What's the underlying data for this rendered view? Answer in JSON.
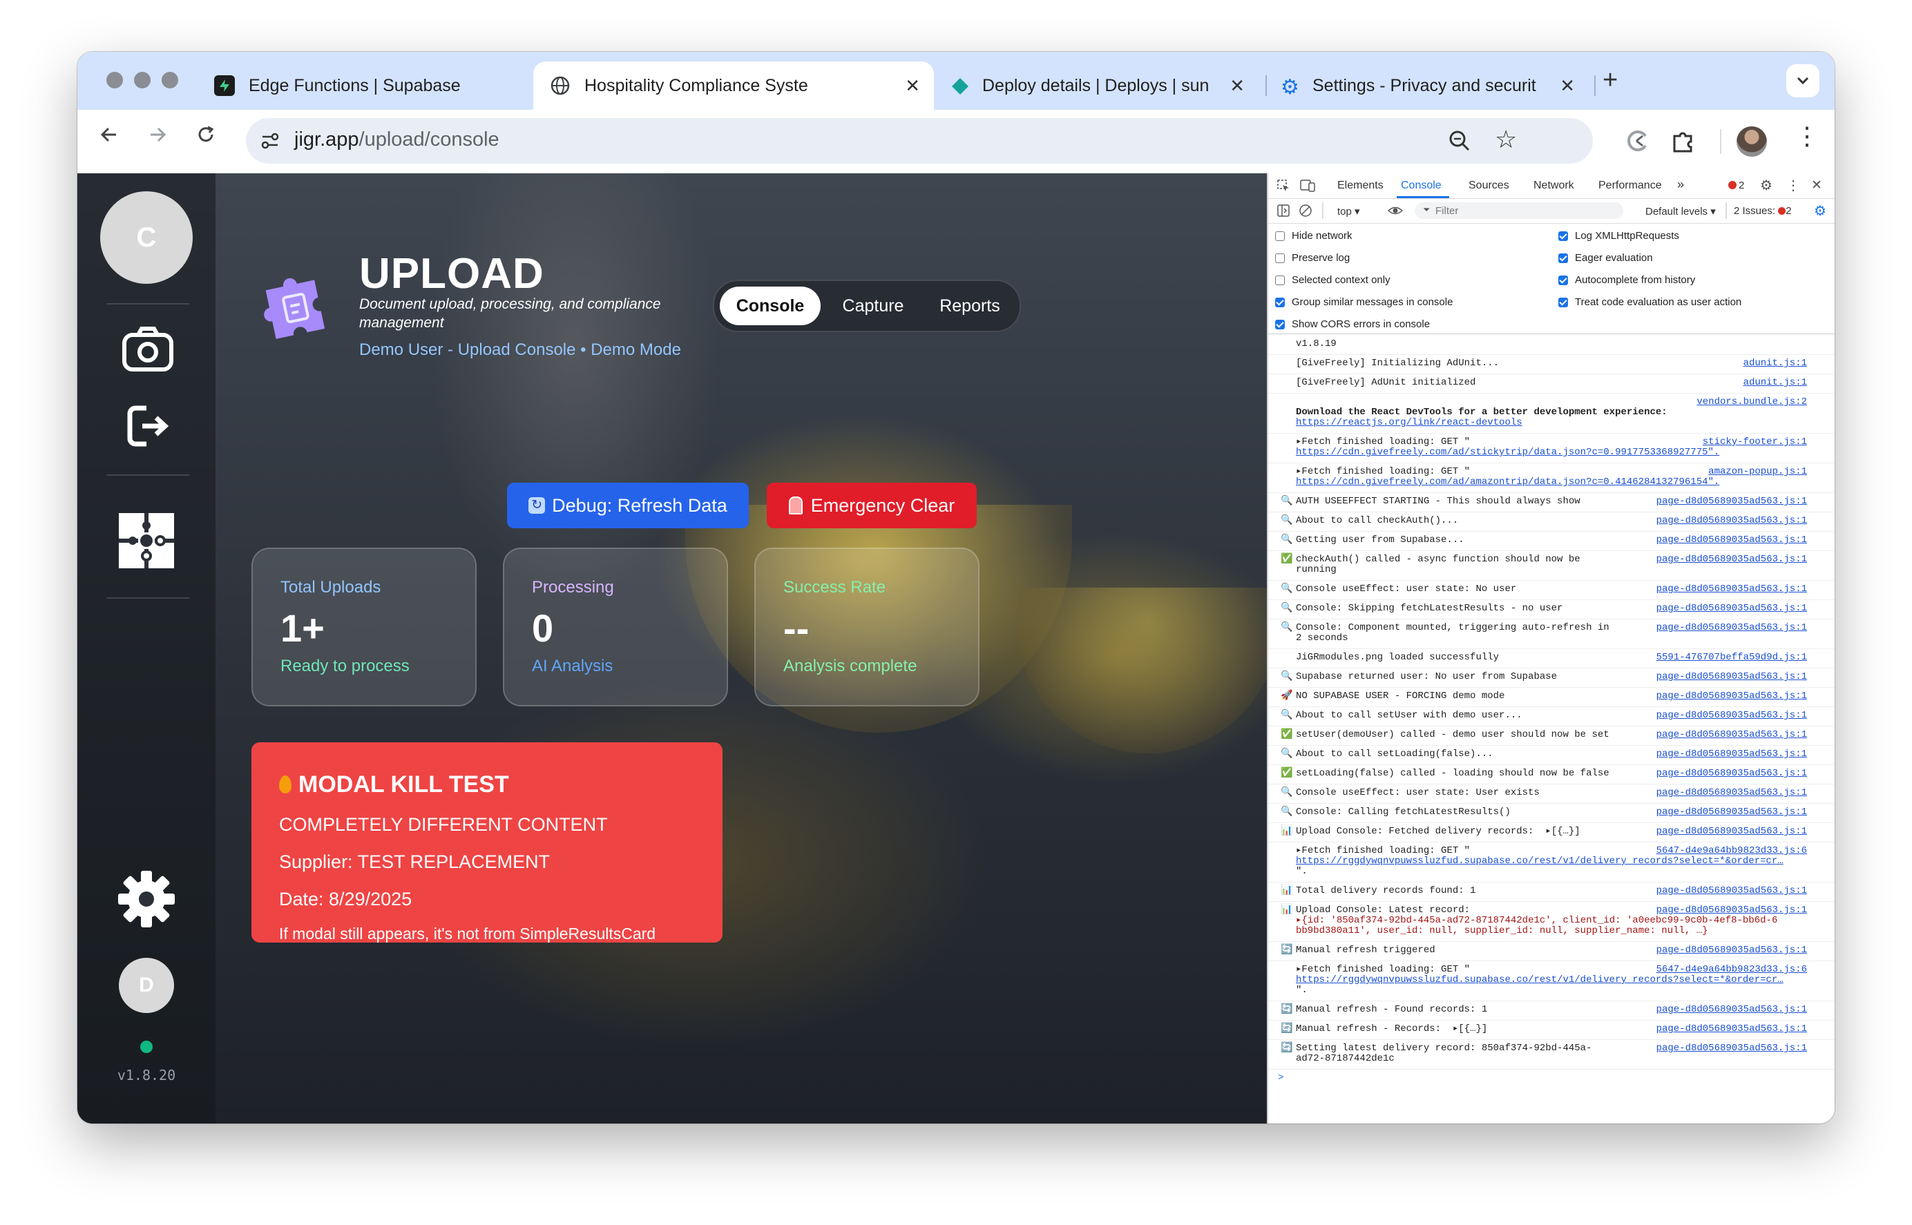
{
  "browser": {
    "tabs": [
      {
        "title": "Edge Functions | Supabase"
      },
      {
        "title": "Hospitality Compliance Syste"
      },
      {
        "title": "Deploy details | Deploys | sun"
      },
      {
        "title": "Settings - Privacy and securit"
      }
    ],
    "url_host": "jigr.app",
    "url_path": "/upload/console"
  },
  "app": {
    "avatar_initial": "C",
    "user_initial": "D",
    "version": "v1.8.20",
    "header": {
      "title": "UPLOAD",
      "subtitle_line1": "Document upload, processing, and compliance",
      "subtitle_line2": "management",
      "context": "Demo User - Upload Console • Demo Mode"
    },
    "nav": [
      "Console",
      "Capture",
      "Reports"
    ],
    "buttons": {
      "debug": "Debug: Refresh Data",
      "emergency": "Emergency Clear"
    },
    "stats": [
      {
        "label": "Total Uploads",
        "value": "1+",
        "sub": "Ready to process"
      },
      {
        "label": "Processing",
        "value": "0",
        "sub": "AI Analysis"
      },
      {
        "label": "Success Rate",
        "value": "--",
        "sub": "Analysis complete"
      }
    ],
    "test_card": {
      "title": "MODAL KILL TEST",
      "line1": "COMPLETELY DIFFERENT CONTENT",
      "line2": "Supplier: TEST REPLACEMENT",
      "line3": "Date: 8/29/2025",
      "line4": "If modal still appears, it's not from SimpleResultsCard"
    },
    "colors": {
      "accent_blue": "#2563eb",
      "danger": "#ef4444",
      "online": "#10b981"
    }
  },
  "devtools": {
    "tabs": [
      "Elements",
      "Console",
      "Sources",
      "Network",
      "Performance"
    ],
    "error_count": "2",
    "context": "top",
    "filter_placeholder": "Filter",
    "levels": "Default levels",
    "issues_label": "2 Issues:",
    "issues_count": "2",
    "settings_left": [
      {
        "label": "Hide network",
        "checked": false
      },
      {
        "label": "Preserve log",
        "checked": false
      },
      {
        "label": "Selected context only",
        "checked": false
      },
      {
        "label": "Group similar messages in console",
        "checked": true
      },
      {
        "label": "Show CORS errors in console",
        "checked": true
      }
    ],
    "settings_right": [
      {
        "label": "Log XMLHttpRequests",
        "checked": true
      },
      {
        "label": "Eager evaluation",
        "checked": true
      },
      {
        "label": "Autocomplete from history",
        "checked": true
      },
      {
        "label": "Treat code evaluation as user action",
        "checked": true
      }
    ],
    "log": [
      {
        "lines": [
          "v1.8.19"
        ],
        "source": ""
      },
      {
        "lines": [
          "[GiveFreely] Initializing AdUnit..."
        ],
        "source": "adunit.js:1"
      },
      {
        "lines": [
          "[GiveFreely] AdUnit initialized"
        ],
        "source": "adunit.js:1"
      },
      {
        "lines": [
          "",
          "Download the React DevTools for a better development experience:",
          "https://reactjs.org/link/react-devtools"
        ],
        "source": "vendors.bundle.js:2"
      },
      {
        "lines": [
          "▸Fetch finished loading: GET \"",
          "https://cdn.givefreely.com/ad/stickytrip/data.json?c=0.9917753368927775\"."
        ],
        "source": "sticky-footer.js:1"
      },
      {
        "lines": [
          "▸Fetch finished loading: GET \"",
          "https://cdn.givefreely.com/ad/amazontrip/data.json?c=0.4146284132796154\"."
        ],
        "source": "amazon-popup.js:1"
      },
      {
        "icon": "🔍",
        "lines": [
          "AUTH USEEFFECT STARTING - This should always show"
        ],
        "source": "page-d8d05689035ad563.js:1"
      },
      {
        "icon": "🔍",
        "lines": [
          "About to call checkAuth()..."
        ],
        "source": "page-d8d05689035ad563.js:1"
      },
      {
        "icon": "🔍",
        "lines": [
          "Getting user from Supabase..."
        ],
        "source": "page-d8d05689035ad563.js:1"
      },
      {
        "icon": "✅",
        "lines": [
          "checkAuth() called - async function should now be",
          "running"
        ],
        "source": "page-d8d05689035ad563.js:1"
      },
      {
        "icon": "🔍",
        "lines": [
          "Console useEffect: user state: No user"
        ],
        "source": "page-d8d05689035ad563.js:1"
      },
      {
        "icon": "🔍",
        "lines": [
          "Console: Skipping fetchLatestResults - no user"
        ],
        "source": "page-d8d05689035ad563.js:1"
      },
      {
        "icon": "🔍",
        "lines": [
          "Console: Component mounted, triggering auto-refresh in",
          "2 seconds"
        ],
        "source": "page-d8d05689035ad563.js:1"
      },
      {
        "lines": [
          "JiGRmodules.png loaded successfully"
        ],
        "source": "5591-476707beffa59d9d.js:1"
      },
      {
        "icon": "🔍",
        "lines": [
          "Supabase returned user: No user from Supabase"
        ],
        "source": "page-d8d05689035ad563.js:1"
      },
      {
        "icon": "🚀",
        "lines": [
          "NO SUPABASE USER - FORCING demo mode"
        ],
        "source": "page-d8d05689035ad563.js:1"
      },
      {
        "icon": "🔍",
        "lines": [
          "About to call setUser with demo user..."
        ],
        "source": "page-d8d05689035ad563.js:1"
      },
      {
        "icon": "✅",
        "lines": [
          "setUser(demoUser) called - demo user should now be set"
        ],
        "source": "page-d8d05689035ad563.js:1"
      },
      {
        "icon": "🔍",
        "lines": [
          "About to call setLoading(false)..."
        ],
        "source": "page-d8d05689035ad563.js:1"
      },
      {
        "icon": "✅",
        "lines": [
          "setLoading(false) called - loading should now be false"
        ],
        "source": "page-d8d05689035ad563.js:1"
      },
      {
        "icon": "🔍",
        "lines": [
          "Console useEffect: user state: User exists"
        ],
        "source": "page-d8d05689035ad563.js:1"
      },
      {
        "icon": "🔍",
        "lines": [
          "Console: Calling fetchLatestResults()"
        ],
        "source": "page-d8d05689035ad563.js:1"
      },
      {
        "icon": "📊",
        "lines": [
          "Upload Console: Fetched delivery records:  ▸[{…}]"
        ],
        "source": "page-d8d05689035ad563.js:1"
      },
      {
        "lines": [
          "▸Fetch finished loading: GET \"",
          "https://rggdywqnvpuwssluzfud.supabase.co/rest/v1/delivery_records?select=*&order=cr…",
          "\"."
        ],
        "source": "5647-d4e9a64bb9823d33.js:6"
      },
      {
        "icon": "📊",
        "lines": [
          "Total delivery records found: 1"
        ],
        "source": "page-d8d05689035ad563.js:1"
      },
      {
        "icon": "📊",
        "lines": [
          "Upload Console: Latest record:",
          "▸{id: '850af374-92bd-445a-ad72-87187442de1c', client_id: 'a0eebc99-9c0b-4ef8-bb6d-6",
          "bb9bd380a11', user_id: null, supplier_id: null, supplier_name: null, …}"
        ],
        "source": "page-d8d05689035ad563.js:1"
      },
      {
        "icon": "🔄",
        "lines": [
          "Manual refresh triggered"
        ],
        "source": "page-d8d05689035ad563.js:1"
      },
      {
        "lines": [
          "▸Fetch finished loading: GET \"",
          "https://rggdywqnvpuwssluzfud.supabase.co/rest/v1/delivery_records?select=*&order=cr…",
          "\"."
        ],
        "source": "5647-d4e9a64bb9823d33.js:6"
      },
      {
        "icon": "🔄",
        "lines": [
          "Manual refresh - Found records: 1"
        ],
        "source": "page-d8d05689035ad563.js:1"
      },
      {
        "icon": "🔄",
        "lines": [
          "Manual refresh - Records:  ▸[{…}]"
        ],
        "source": "page-d8d05689035ad563.js:1"
      },
      {
        "icon": "🔄",
        "lines": [
          "Setting latest delivery record: 850af374-92bd-445a-",
          "ad72-87187442de1c"
        ],
        "source": "page-d8d05689035ad563.js:1"
      }
    ],
    "prompt": ">"
  }
}
